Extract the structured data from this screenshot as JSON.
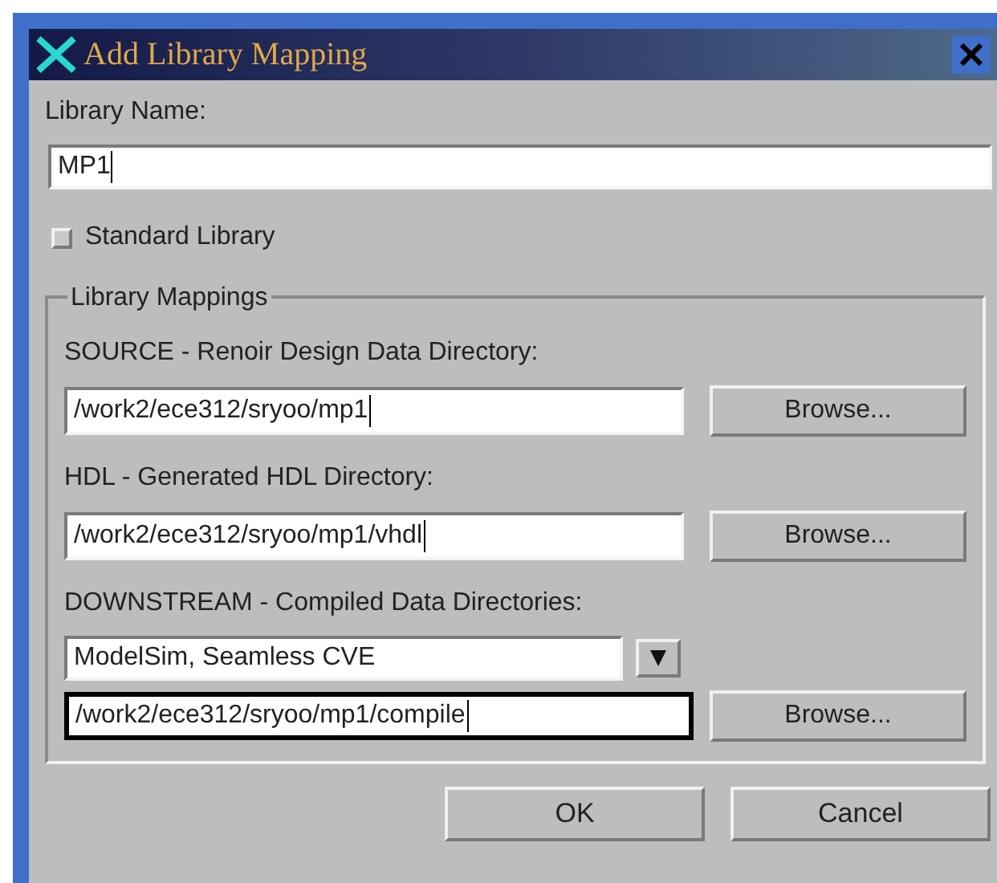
{
  "window": {
    "title": "Add Library Mapping"
  },
  "library_name": {
    "label": "Library Name:",
    "value": "MP1"
  },
  "standard_library": {
    "label": "Standard Library",
    "checked": false
  },
  "mappings": {
    "title": "Library Mappings",
    "rows": [
      {
        "kind": "path",
        "label": "SOURCE - Renoir Design Data Directory:",
        "value": "/work2/ece312/sryoo/mp1",
        "focused": false,
        "button": "Browse..."
      },
      {
        "kind": "path",
        "label": "HDL - Generated HDL Directory:",
        "value": "/work2/ece312/sryoo/mp1/vhdl",
        "focused": false,
        "button": "Browse..."
      },
      {
        "kind": "dropdown",
        "label": "DOWNSTREAM - Compiled Data Directories:",
        "value": "ModelSim, Seamless CVE"
      },
      {
        "kind": "path",
        "value": "/work2/ece312/sryoo/mp1/compile",
        "focused": true,
        "button": "Browse..."
      }
    ]
  },
  "buttons": [
    "OK",
    "Cancel"
  ]
}
